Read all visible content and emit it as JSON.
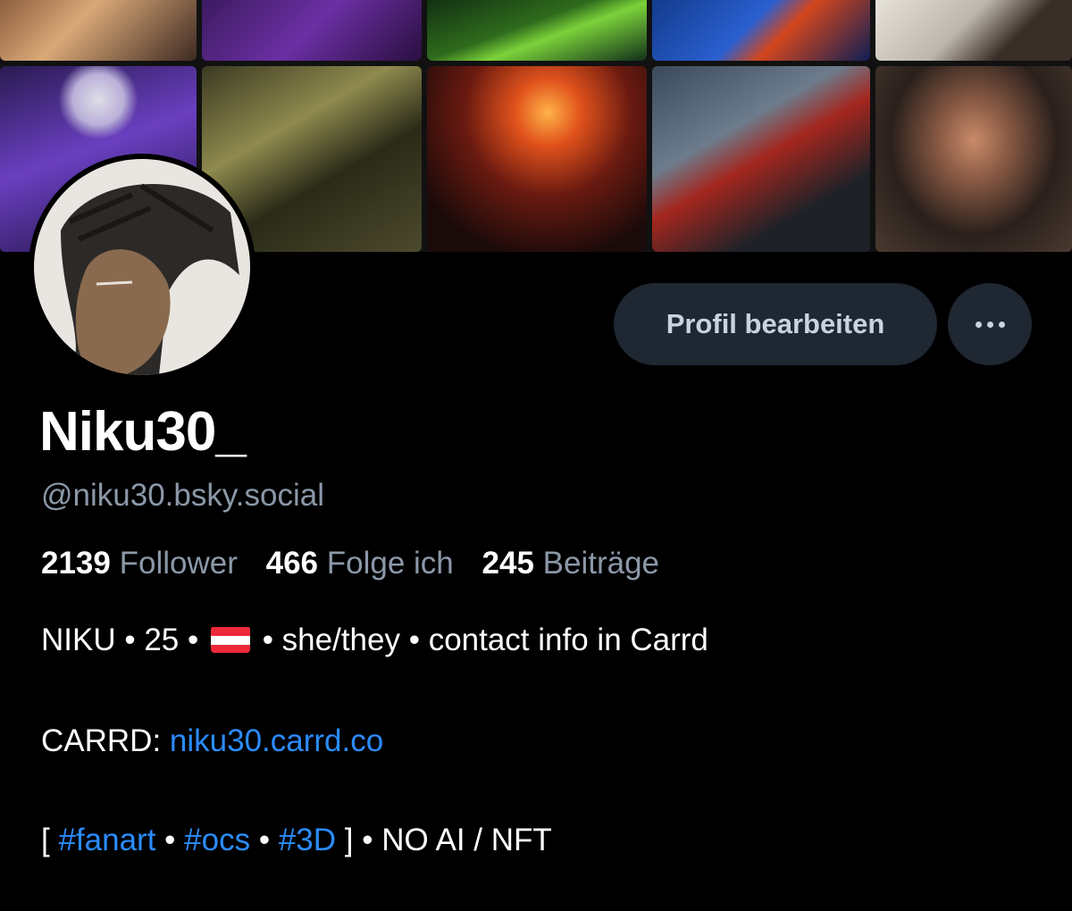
{
  "profile": {
    "display_name": "Niku30_",
    "handle": "@niku30.bsky.social",
    "edit_button_label": "Profil bearbeiten",
    "more_button_icon": "more-horizontal-icon"
  },
  "stats": [
    {
      "value": "2139",
      "label": "Follower"
    },
    {
      "value": "466",
      "label": "Folge ich"
    },
    {
      "value": "245",
      "label": "Beiträge"
    }
  ],
  "bio": {
    "line1_prefix": "NIKU • 25 •",
    "line1_flag": "austria-flag-icon",
    "line1_suffix": "• she/they • contact info in Carrd",
    "line2_prefix": "CARRD:",
    "line2_link": "niku30.carrd.co",
    "line3_open": "[",
    "tag1": "#fanart",
    "sep": "•",
    "tag2": "#ocs",
    "tag3": "#3D",
    "line3_close": "] • NO AI / NFT"
  },
  "colors": {
    "background": "#000000",
    "button_bg": "#1e2732",
    "muted_text": "#8b98a8",
    "link": "#2b8cff"
  }
}
